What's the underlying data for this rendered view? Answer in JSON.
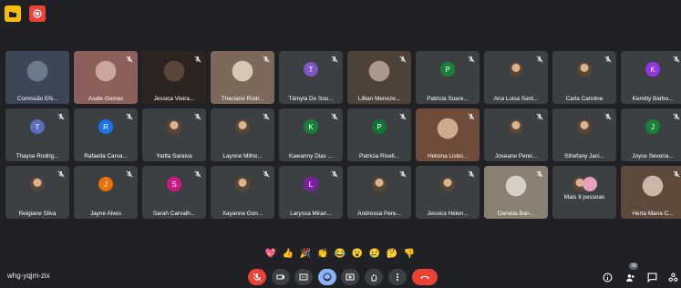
{
  "meeting": {
    "code": "whg-yqjm-zix",
    "participant_count": "38"
  },
  "tiles": [
    {
      "name": "Comissão EN...",
      "type": "video",
      "colors": [
        "#6d7a8b",
        "#3b4756"
      ],
      "speaking": true
    },
    {
      "name": "Asafe Gomes",
      "type": "video",
      "colors": [
        "#c9a7a0",
        "#8d5f5a"
      ]
    },
    {
      "name": "Jessica Vieira...",
      "type": "video",
      "colors": [
        "#5a4638",
        "#2c2420"
      ]
    },
    {
      "name": "Thaciane Rodr...",
      "type": "video",
      "colors": [
        "#d6c7b8",
        "#7b6a5c"
      ]
    },
    {
      "name": "Tâmyla De Sou...",
      "type": "avatar",
      "initial": "T",
      "color": "#7e57c2"
    },
    {
      "name": "Lillian Meneze...",
      "type": "video",
      "colors": [
        "#a8998a",
        "#4e4238"
      ]
    },
    {
      "name": "Patricia Soare...",
      "type": "avatar",
      "initial": "P",
      "color": "#188038"
    },
    {
      "name": "Ana Luisa Sant...",
      "type": "photo"
    },
    {
      "name": "Carla Caroline",
      "type": "photo"
    },
    {
      "name": "Kemilly Barbo...",
      "type": "avatar",
      "initial": "K",
      "color": "#9334e6"
    },
    {
      "name": "Thayse Rodrig...",
      "type": "avatar",
      "initial": "T",
      "color": "#5c6bc0"
    },
    {
      "name": "Rafaella Carva...",
      "type": "avatar",
      "initial": "R",
      "color": "#1a73e8"
    },
    {
      "name": "Yarlla Saraiva",
      "type": "photo"
    },
    {
      "name": "Laynne Milho...",
      "type": "photo"
    },
    {
      "name": "Kawanny Dias ...",
      "type": "avatar",
      "initial": "K",
      "color": "#188038"
    },
    {
      "name": "Patricia Riveli...",
      "type": "avatar",
      "initial": "P",
      "color": "#137333"
    },
    {
      "name": "Heloina Lisbo...",
      "type": "video",
      "colors": [
        "#cfa98e",
        "#6f4b3a"
      ]
    },
    {
      "name": "Joseane Perei...",
      "type": "photo"
    },
    {
      "name": "Sthefany Jaci...",
      "type": "photo"
    },
    {
      "name": "Joyce Severia...",
      "type": "avatar",
      "initial": "J",
      "color": "#188038"
    },
    {
      "name": "Reigiane Silva",
      "type": "photo"
    },
    {
      "name": "Jayne Alves",
      "type": "avatar",
      "initial": "J",
      "color": "#e8710a"
    },
    {
      "name": "Sarah Carvalh...",
      "type": "avatar",
      "initial": "S",
      "color": "#d01884"
    },
    {
      "name": "Xayanne Gon...",
      "type": "photo"
    },
    {
      "name": "Laryssa Miran...",
      "type": "avatar",
      "initial": "L",
      "color": "#7b1fa2"
    },
    {
      "name": "Andressa Pere...",
      "type": "photo"
    },
    {
      "name": "Jessica Helen...",
      "type": "photo"
    },
    {
      "name": "Daniela Ban...",
      "type": "video",
      "colors": [
        "#d8cfc4",
        "#8a7f73"
      ]
    },
    {
      "name": "Mais 9 pessoas",
      "type": "more"
    },
    {
      "name": "Herta Maria C...",
      "type": "video",
      "colors": [
        "#c9b8a8",
        "#5d4a3d"
      ]
    }
  ],
  "reactions": [
    "💖",
    "👍",
    "🎉",
    "👏",
    "😂",
    "😮",
    "😢",
    "🤔",
    "👎"
  ],
  "controls": {
    "mic": "mic-off-icon",
    "camera": "camera-icon",
    "captions": "captions-icon",
    "emoji": "emoji-icon",
    "present": "present-icon",
    "hand": "raise-hand-icon",
    "more": "more-icon",
    "leave": "end-call-icon"
  },
  "colors": {
    "background": "#202124",
    "tile": "#3c4043",
    "accent": "#8ab4f8",
    "danger": "#ea4335"
  }
}
